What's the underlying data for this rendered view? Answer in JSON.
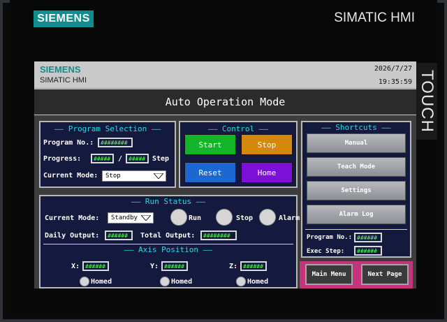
{
  "bezel": {
    "brand": "SIEMENS",
    "title": "SIMATIC HMI",
    "touch": "TOUCH"
  },
  "header": {
    "brand": "SIEMENS",
    "model": "SIMATIC HMI",
    "date": "2026/7/27",
    "time": "19:35:59"
  },
  "page_title": "Auto Operation Mode",
  "program_selection": {
    "title": "—— Program Selection ——",
    "program_no_label": "Program No.:",
    "program_no_value": "########",
    "progress_label": "Progress:",
    "progress_current": "#####",
    "progress_sep": "/",
    "progress_total": "#####",
    "progress_unit": "Step",
    "mode_label": "Current Mode:",
    "mode_value": "Stop"
  },
  "control": {
    "title": "—— Control ——",
    "start": "Start",
    "stop": "Stop",
    "reset": "Reset",
    "home": "Home",
    "colors": {
      "start": "#12b52a",
      "stop": "#d4890d",
      "reset": "#1e66d0",
      "home": "#7c10d8"
    }
  },
  "shortcuts": {
    "title": "—— Shortcuts ——",
    "items": [
      "Manual",
      "Teach Mode",
      "Settings",
      "Alarm Log"
    ],
    "program_no_label": "Program No.:",
    "program_no_value": "######",
    "exec_step_label": "Exec Step:",
    "exec_step_value": "######"
  },
  "run_status": {
    "title": "—— Run Status ——",
    "mode_label": "Current Mode:",
    "mode_value": "Standby",
    "indicators": [
      "Run",
      "Stop",
      "Alarm"
    ],
    "daily_label": "Daily Output:",
    "daily_value": "######",
    "total_label": "Total Output:",
    "total_value": "########"
  },
  "axis": {
    "title": "—— Axis Position ——",
    "axes": [
      {
        "label": "X:",
        "value": "######",
        "homed": "Homed"
      },
      {
        "label": "Y:",
        "value": "######",
        "homed": "Homed"
      },
      {
        "label": "Z:",
        "value": "######",
        "homed": "Homed"
      }
    ]
  },
  "nav": {
    "main_menu": "Main Menu",
    "next_page": "Next Page"
  }
}
